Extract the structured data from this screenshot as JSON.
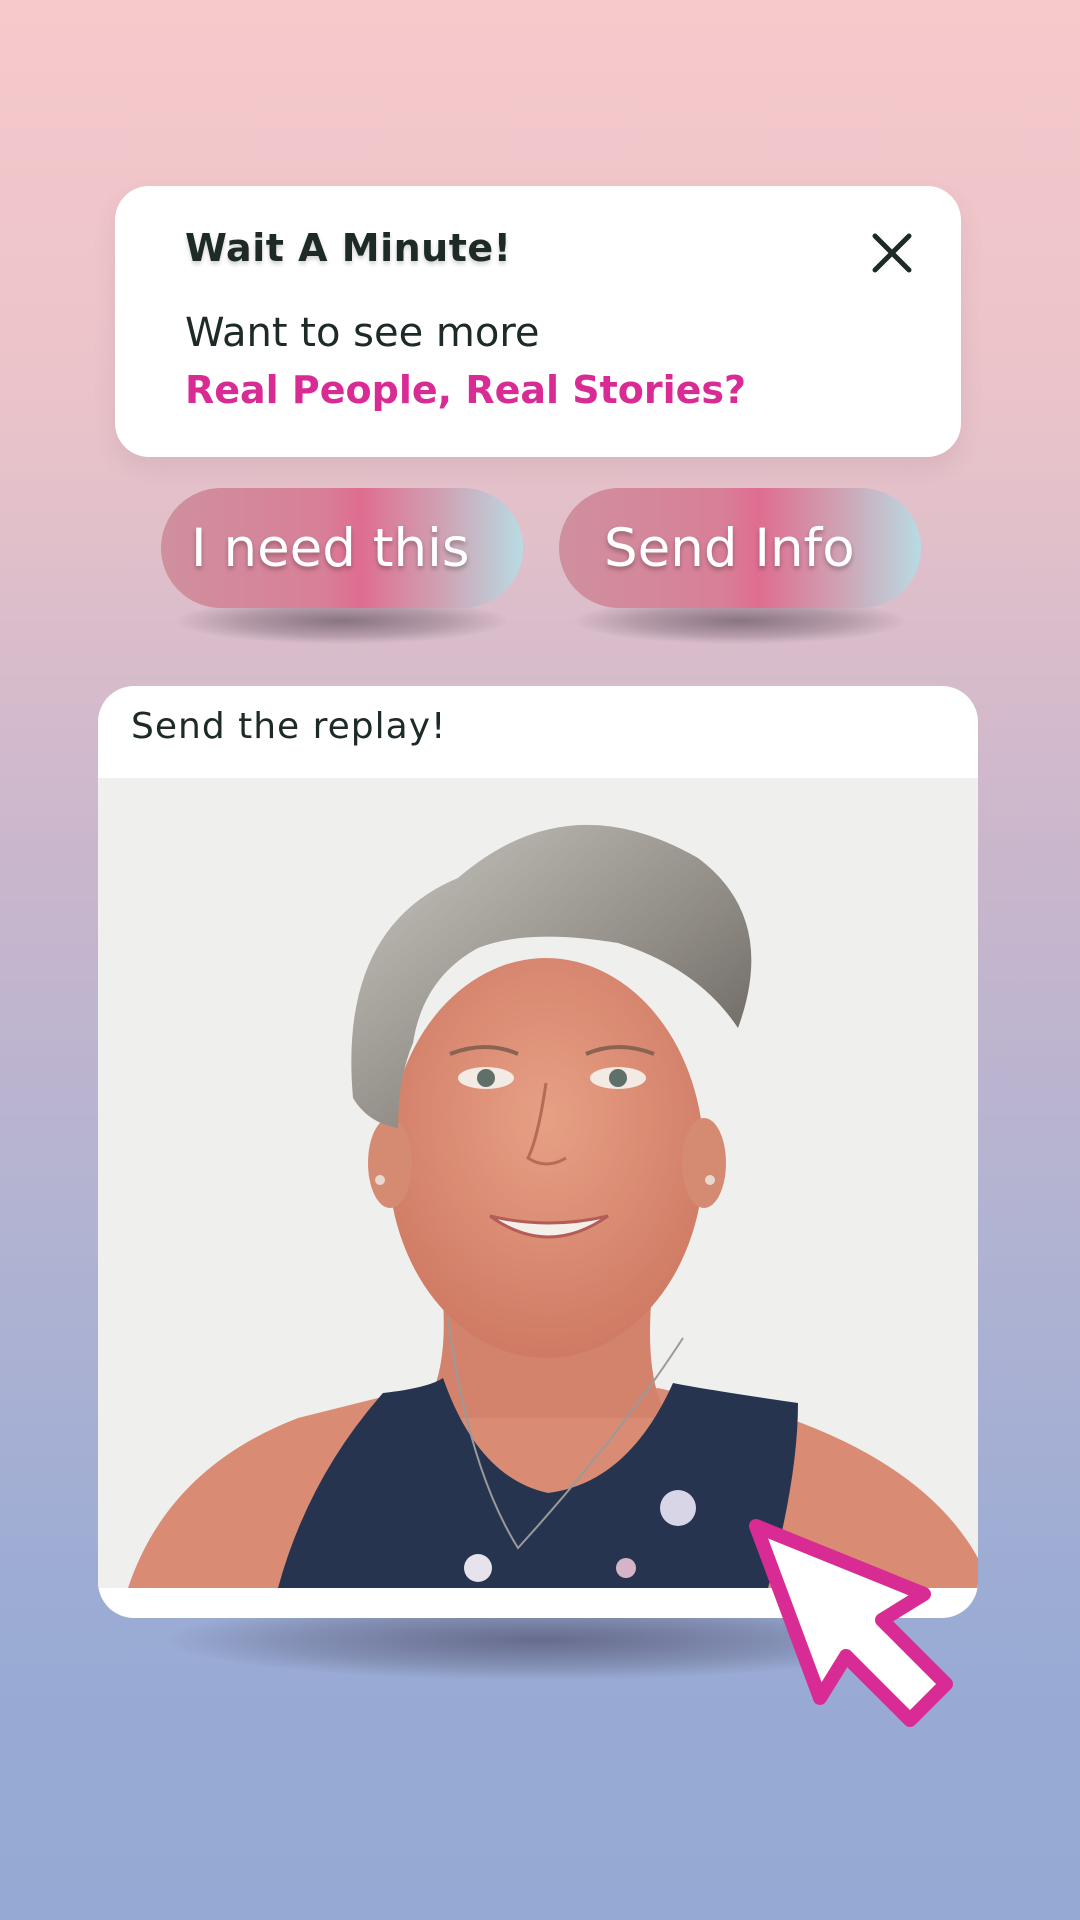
{
  "dialog": {
    "title": "Wait A Minute!",
    "line1": "Want to see more",
    "line2": "Real People, Real Stories?",
    "close_icon": "close-icon"
  },
  "buttons": {
    "primary_label": "I need this",
    "secondary_label": "Send Info"
  },
  "card": {
    "caption": "Send the replay!",
    "photo": "portrait-photo"
  },
  "cursor": "pointer-cursor-icon",
  "colors": {
    "accent": "#d82c94",
    "text_dark": "#1d2a26",
    "background_top": "#f7c9cb",
    "background_bottom": "#94a9d3"
  }
}
